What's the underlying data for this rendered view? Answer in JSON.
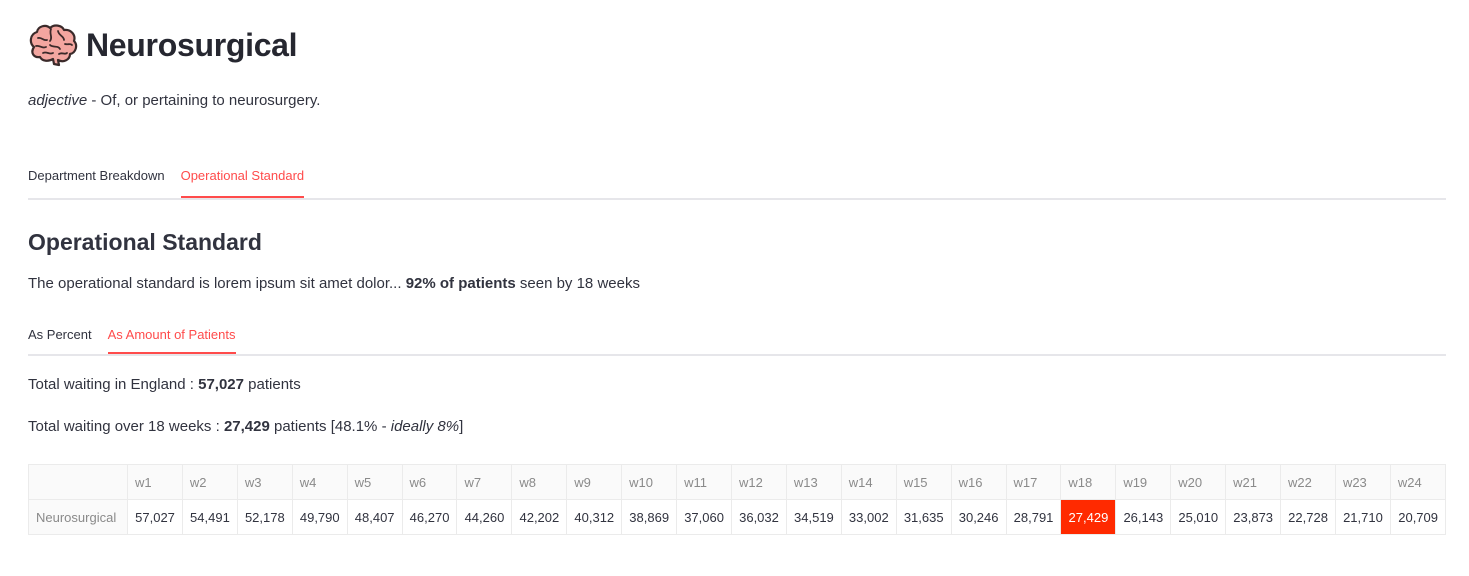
{
  "header": {
    "icon": "brain-icon",
    "title": "Neurosurgical"
  },
  "definition": {
    "part_of_speech": "adjective",
    "text": " - Of, or pertaining to neurosurgery."
  },
  "main_tabs": [
    {
      "label": "Department Breakdown",
      "active": false
    },
    {
      "label": "Operational Standard",
      "active": true
    }
  ],
  "section": {
    "title": "Operational Standard",
    "desc_prefix": "The operational standard is lorem ipsum sit amet dolor... ",
    "desc_bold": "92% of patients",
    "desc_suffix": " seen by 18 weeks"
  },
  "sub_tabs": [
    {
      "label": "As Percent",
      "active": false
    },
    {
      "label": "As Amount of Patients",
      "active": true
    }
  ],
  "stats": {
    "total_label": "Total waiting in England : ",
    "total_value": "57,027",
    "total_suffix": " patients",
    "over_label": "Total waiting over 18 weeks : ",
    "over_value": "27,429",
    "over_suffix": " patients [48.1% - ",
    "over_ideal": "ideally 8%",
    "over_close": "]"
  },
  "table": {
    "columns": [
      "w1",
      "w2",
      "w3",
      "w4",
      "w5",
      "w6",
      "w7",
      "w8",
      "w9",
      "w10",
      "w11",
      "w12",
      "w13",
      "w14",
      "w15",
      "w16",
      "w17",
      "w18",
      "w19",
      "w20",
      "w21",
      "w22",
      "w23",
      "w24"
    ],
    "row_label": "Neurosurgical",
    "values": [
      "57,027",
      "54,491",
      "52,178",
      "49,790",
      "48,407",
      "46,270",
      "44,260",
      "42,202",
      "40,312",
      "38,869",
      "37,060",
      "36,032",
      "34,519",
      "33,002",
      "31,635",
      "30,246",
      "28,791",
      "27,429",
      "26,143",
      "25,010",
      "23,873",
      "22,728",
      "21,710",
      "20,709"
    ],
    "highlight_column": "w18",
    "highlight_color": "#ff2a00"
  },
  "colors": {
    "accent": "#ff4b4b",
    "text": "#31333f"
  }
}
